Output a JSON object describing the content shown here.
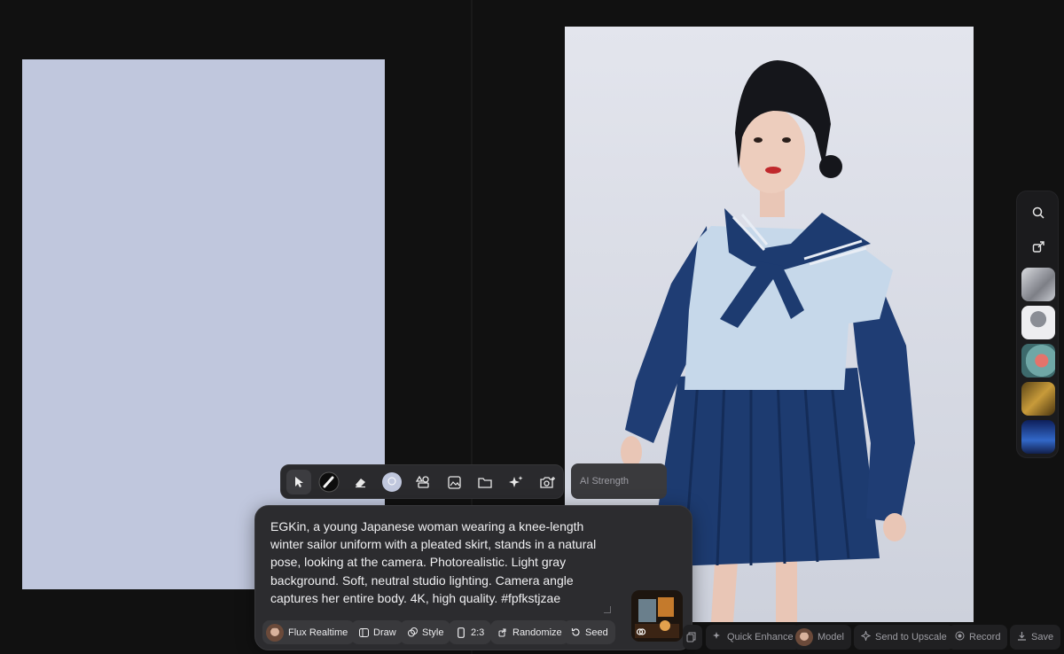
{
  "canvas": {
    "background_color": "#c0c7dd"
  },
  "toolbar": {
    "tools": [
      {
        "name": "select-tool",
        "icon": "pointer-icon"
      },
      {
        "name": "brush-tool",
        "icon": "brush-icon"
      },
      {
        "name": "eraser-tool",
        "icon": "eraser-icon"
      },
      {
        "name": "color-tool",
        "icon": "color-picker-icon"
      },
      {
        "name": "shapes-tool",
        "icon": "shapes-icon"
      },
      {
        "name": "image-tool",
        "icon": "image-icon"
      },
      {
        "name": "folder-tool",
        "icon": "folder-icon"
      },
      {
        "name": "magic-tool",
        "icon": "sparkles-icon"
      },
      {
        "name": "camera-tool",
        "icon": "camera-icon"
      }
    ],
    "ai_strength_placeholder": "AI Strength"
  },
  "prompt": {
    "text": "EGKin, a young Japanese woman wearing a knee-length winter sailor uniform with a pleated skirt, stands in a natural pose, looking at the camera. Photorealistic. Light gray background. Soft, neutral studio lighting. Camera angle captures her entire body. 4K, high quality. #fpfkstjzae"
  },
  "prompt_controls": {
    "model_label": "Flux Realtime",
    "draw_label": "Draw",
    "style_label": "Style",
    "ratio_label": "2:3",
    "randomize_label": "Randomize",
    "seed_label": "Seed"
  },
  "actions": {
    "quick_enhance": "Quick Enhance",
    "model": "Model",
    "send_to_upscale": "Send to Upscale",
    "record": "Record",
    "save": "Save"
  },
  "sidebar": {
    "icons": [
      "search-icon",
      "share-icon"
    ],
    "history_count": 5
  },
  "colors": {
    "background": "#111111",
    "panel": "#2c2c2f",
    "uniform_navy": "#1d3b70",
    "blouse_light": "#c9d9ea"
  }
}
